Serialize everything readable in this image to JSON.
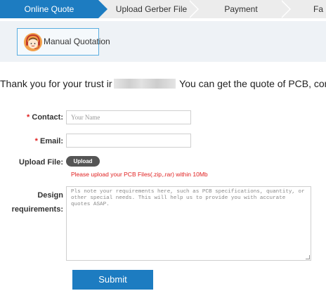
{
  "steps": [
    {
      "label": "Online Quote",
      "active": true
    },
    {
      "label": "Upload Gerber File",
      "active": false
    },
    {
      "label": "Payment",
      "active": false
    },
    {
      "label": "Fa",
      "active": false
    }
  ],
  "manual_quote": {
    "label": "Manual Quotation",
    "icon": "customer-service-headset-icon"
  },
  "thanks": {
    "before": "Thank you for your trust ir",
    "after": "You can get the quote of PCB, comp"
  },
  "form": {
    "contact_label": "Contact:",
    "contact_placeholder": "Your Name",
    "email_label": "Email:",
    "email_placeholder": "",
    "required_mark": "*",
    "upload_label": "Upload File:",
    "upload_button": "Upload",
    "upload_note": "Please upload your PCB Files(.zip,.rar) within 10Mb",
    "design_label_line1": "Design",
    "design_label_line2": "requirements:",
    "design_placeholder": "Pls note your requirements here, such as PCB specifications, quantity, or other special needs. This will help us to provide you with accurate quotes ASAP.",
    "submit_label": "Submit"
  },
  "colors": {
    "accent": "#1d7cc1",
    "required": "#e02020",
    "band": "#eef2f6"
  }
}
